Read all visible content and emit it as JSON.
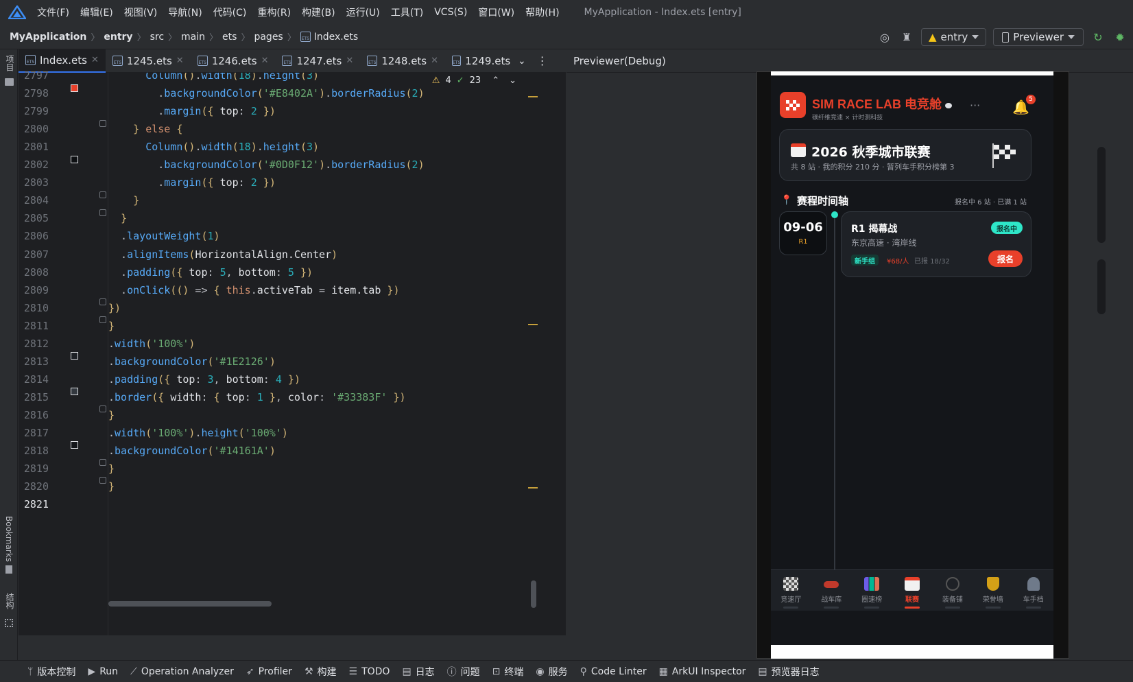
{
  "menubar": {
    "items": [
      "文件(F)",
      "编辑(E)",
      "视图(V)",
      "导航(N)",
      "代码(C)",
      "重构(R)",
      "构建(B)",
      "运行(U)",
      "工具(T)",
      "VCS(S)",
      "窗口(W)",
      "帮助(H)"
    ],
    "window_title": "MyApplication - Index.ets [entry]"
  },
  "navbar": {
    "breadcrumbs": [
      "MyApplication",
      "entry",
      "src",
      "main",
      "ets",
      "pages",
      "Index.ets"
    ],
    "module_dropdown": "entry",
    "previewer_dropdown": "Previewer"
  },
  "leftbar": {
    "project_label": "项目",
    "bookmarks_label": "Bookmarks",
    "structure_label": "结构"
  },
  "tabs": [
    "Index.ets",
    "1245.ets",
    "1246.ets",
    "1247.ets",
    "1248.ets",
    "1249.ets"
  ],
  "inspections": {
    "warnings": "4",
    "ok": "23"
  },
  "editor": {
    "line_numbers": [
      "2797",
      "2798",
      "2799",
      "2800",
      "2801",
      "2802",
      "2803",
      "2804",
      "2805",
      "2806",
      "2807",
      "2808",
      "2809",
      "2810",
      "2811",
      "2812",
      "2813",
      "2814",
      "2815",
      "2816",
      "2817",
      "2818",
      "2819",
      "2820",
      "2821"
    ],
    "lines": [
      "      Column().width(18).height(3)",
      "        .backgroundColor('#E8402A').borderRadius(2)",
      "        .margin({ top: 2 })",
      "    } else {",
      "      Column().width(18).height(3)",
      "        .backgroundColor('#0D0F12').borderRadius(2)",
      "        .margin({ top: 2 })",
      "    }",
      "  }",
      "  .layoutWeight(1)",
      "  .alignItems(HorizontalAlign.Center)",
      "  .padding({ top: 5, bottom: 5 })",
      "  .onClick(() => { this.activeTab = item.tab })",
      "})",
      "}",
      ".width('100%')",
      ".backgroundColor('#1E2126')",
      ".padding({ top: 3, bottom: 4 })",
      ".border({ width: { top: 1 }, color: '#33383F' })",
      "}",
      ".width('100%').height('100%')",
      ".backgroundColor('#14161A')",
      "}",
      "}",
      ""
    ]
  },
  "previewer": {
    "header": "Previewer(Debug)"
  },
  "app": {
    "title": "SIM RACE LAB 电竞舱",
    "subtitle": "碳纤维竞速 × 计时测科技",
    "notification_count": "5",
    "season": {
      "title": "2026 秋季城市联赛",
      "desc": "共 8 站 · 我的积分 210 分 · 暂列车手积分榜第 3"
    },
    "timeline": {
      "title": "赛程时间轴",
      "summary": "报名中 6 站 · 已满 1 站"
    },
    "event": {
      "date": "09-06",
      "round": "R1",
      "name": "R1 揭幕战",
      "venue": "东京高速 · 湾岸线",
      "status": "报名中",
      "tag": "新手组",
      "price": "¥68/人",
      "signed": "已报 18/32",
      "button": "报名"
    },
    "tabs": [
      "竞速厅",
      "战车库",
      "圈速榜",
      "联赛",
      "装备铺",
      "荣誉墙",
      "车手档"
    ],
    "active_tab": "联赛"
  },
  "bottombar": [
    "版本控制",
    "Run",
    "Operation Analyzer",
    "Profiler",
    "构建",
    "TODO",
    "日志",
    "问题",
    "终端",
    "服务",
    "Code Linter",
    "ArkUI Inspector",
    "预览器日志"
  ],
  "colors": {
    "accent": "#E8402A",
    "teal": "#2EE6C8",
    "bg": "#14161A",
    "card": "#1E2126",
    "border": "#33383F"
  }
}
